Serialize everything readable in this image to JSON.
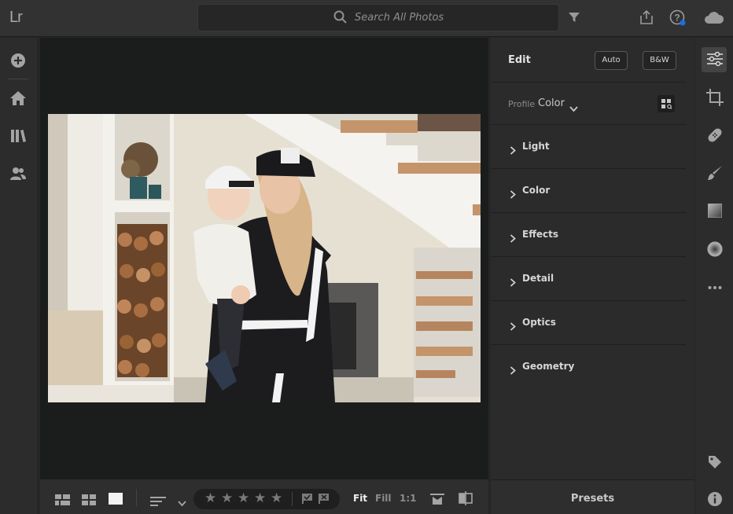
{
  "app": {
    "logo": "Lr"
  },
  "search": {
    "placeholder": "Search All Photos"
  },
  "top_icons": [
    "filter-icon",
    "share-icon",
    "help-icon",
    "cloud-icon"
  ],
  "left_rail": [
    "add-photos-icon",
    "home-icon",
    "library-icon",
    "people-icon"
  ],
  "edit_panel": {
    "title": "Edit",
    "auto_label": "Auto",
    "bw_label": "B&W",
    "profile_label": "Profile",
    "profile_value": "Color",
    "sections": [
      "Light",
      "Color",
      "Effects",
      "Detail",
      "Optics",
      "Geometry"
    ]
  },
  "right_rail": [
    "edit-sliders-icon",
    "crop-icon",
    "healing-icon",
    "brush-icon",
    "linear-gradient-icon",
    "radial-gradient-icon",
    "more-icon",
    "tag-icon",
    "info-icon"
  ],
  "bottom_bar": {
    "view_modes": [
      "square-grid-icon",
      "photo-grid-icon",
      "detail-view-icon"
    ],
    "sort_icon": "sort-icon",
    "rating": 0,
    "stars": [
      "★",
      "★",
      "★",
      "★",
      "★"
    ],
    "flags": [
      "pick-flag-icon",
      "reject-flag-icon"
    ],
    "zoom": {
      "fit": "Fit",
      "fill": "Fill",
      "one_to_one": "1:1"
    },
    "extra_icons": [
      "compare-icon",
      "before-after-icon"
    ]
  },
  "presets": {
    "label": "Presets"
  },
  "colors": {
    "accent_dot": "#1473e6",
    "panel_bg": "#2b2b2b",
    "canvas_bg": "#1b1d1d"
  }
}
